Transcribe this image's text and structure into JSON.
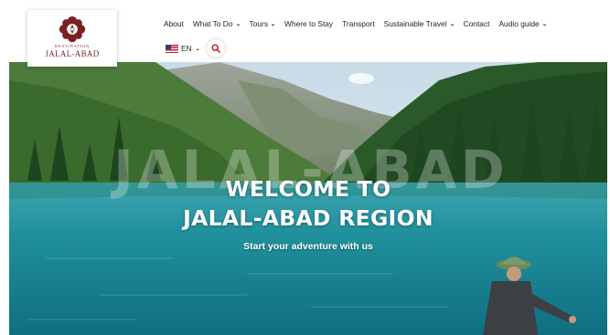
{
  "logo": {
    "small_text": "DESTINATION",
    "big_text": "JALAL-ABAD",
    "brand_color": "#7a1f24"
  },
  "nav": {
    "items": [
      {
        "label": "About",
        "has_dropdown": false
      },
      {
        "label": "What To Do",
        "has_dropdown": true
      },
      {
        "label": "Tours",
        "has_dropdown": true
      },
      {
        "label": "Where to Stay",
        "has_dropdown": false
      },
      {
        "label": "Transport",
        "has_dropdown": false
      },
      {
        "label": "Sustainable Travel",
        "has_dropdown": true
      },
      {
        "label": "Contact",
        "has_dropdown": false
      },
      {
        "label": "Audio guide",
        "has_dropdown": true
      }
    ],
    "chevron_glyph": "❯",
    "language": {
      "code": "EN",
      "flag_icon": "us-flag-icon"
    },
    "search_icon": "search-icon",
    "accent_color": "#c4242b"
  },
  "hero": {
    "watermark": "JALAL-ABAD",
    "heading_line1": "WELCOME TO",
    "heading_line2": "JALAL-ABAD REGION",
    "tagline": "Start your adventure with us"
  }
}
